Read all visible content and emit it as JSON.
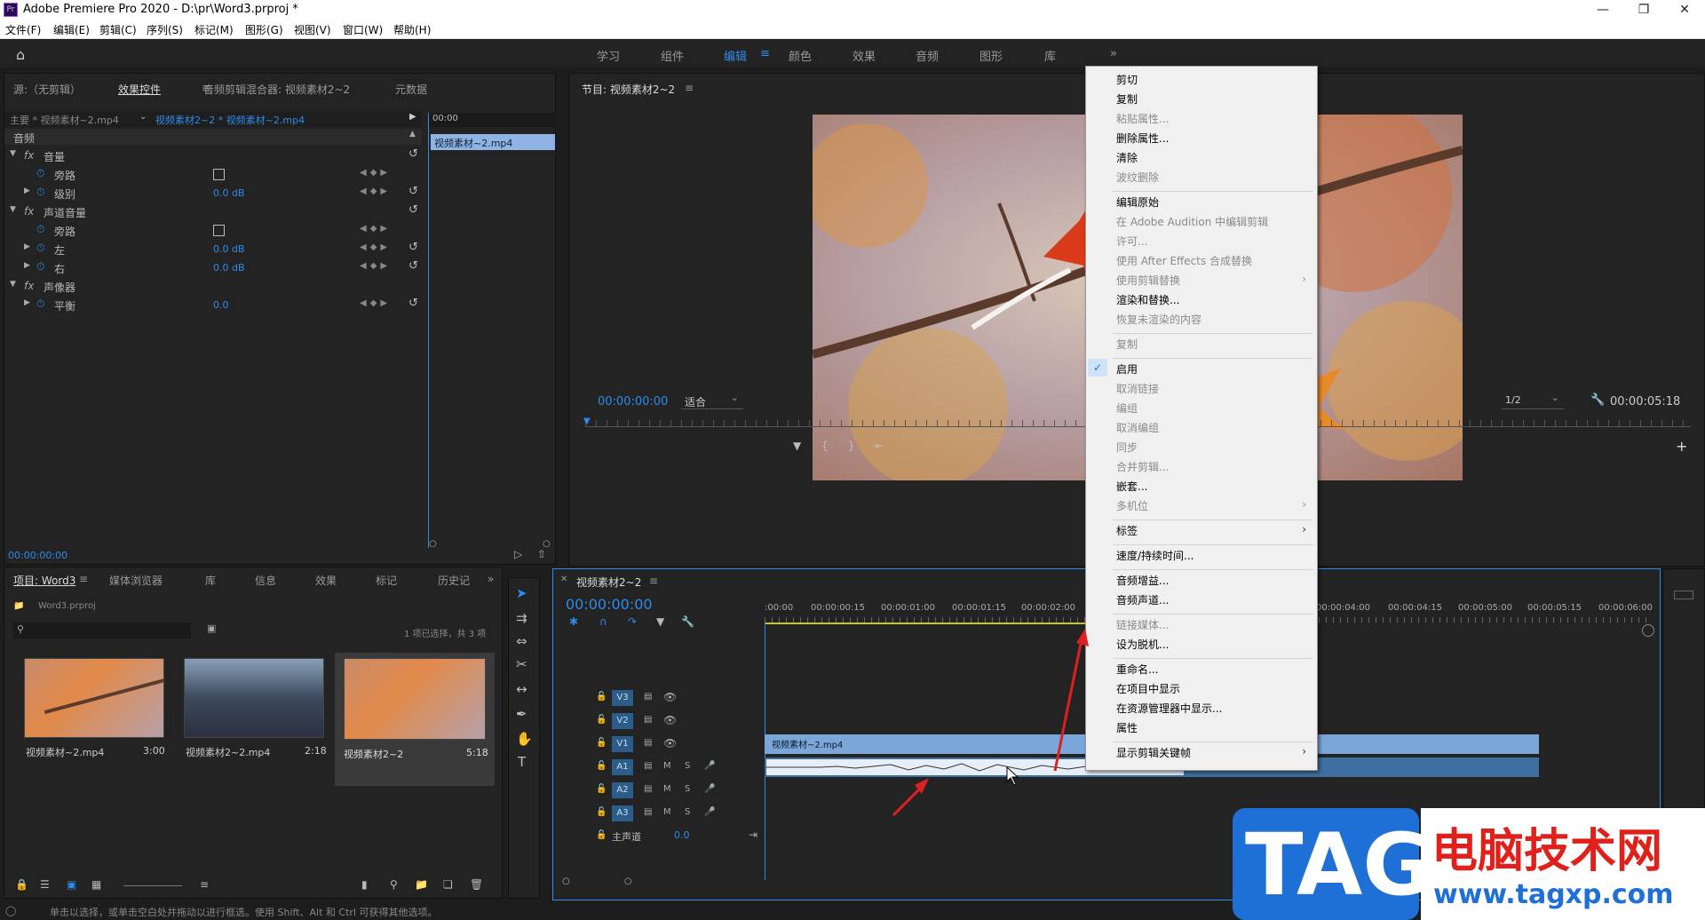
{
  "window": {
    "title": "Adobe Premiere Pro 2020 - D:\\pr\\Word3.prproj *",
    "app_icon": "Pr"
  },
  "menu": [
    "文件(F)",
    "编辑(E)",
    "剪辑(C)",
    "序列(S)",
    "标记(M)",
    "图形(G)",
    "视图(V)",
    "窗口(W)",
    "帮助(H)"
  ],
  "workspaces": [
    "学习",
    "组件",
    "编辑",
    "颜色",
    "效果",
    "音频",
    "图形",
    "库"
  ],
  "workspace_more": "»",
  "source_panel": {
    "tabs": [
      "源:（无剪辑）",
      "效果控件",
      "音频剪辑混合器: 视频素材2~2",
      "元数据"
    ],
    "tab_menu": "≡",
    "clip_path_main": "主要 * 视频素材~2.mp4",
    "clip_path_seq": "视频素材2~2 * 视频素材~2.mp4",
    "mini_time": "00:00",
    "mini_clip": "视频素材~2.mp4",
    "section": "音频",
    "rows": [
      {
        "label": "音量",
        "type": "fx"
      },
      {
        "label": "旁路",
        "type": "check"
      },
      {
        "label": "级别",
        "type": "value",
        "value": "0.0 dB"
      },
      {
        "label": "声道音量",
        "type": "fx"
      },
      {
        "label": "旁路",
        "type": "check"
      },
      {
        "label": "左",
        "type": "value",
        "value": "0.0 dB"
      },
      {
        "label": "右",
        "type": "value",
        "value": "0.0 dB"
      },
      {
        "label": "声像器",
        "type": "fx"
      },
      {
        "label": "平衡",
        "type": "value",
        "value": "0.0"
      }
    ],
    "timecode": "00:00:00:00"
  },
  "program_panel": {
    "title": "节目: 视频素材2~2",
    "timecode": "00:00:00:00",
    "fit": "适合",
    "resolution": "1/2",
    "duration": "00:00:05:18"
  },
  "project_panel": {
    "tabs": [
      "项目: Word3",
      "媒体浏览器",
      "库",
      "信息",
      "效果",
      "标记",
      "历史记"
    ],
    "file": "Word3.prproj",
    "selection": "1 项已选择，共 3 项",
    "items": [
      {
        "name": "视频素材~2.mp4",
        "dur": "3:00"
      },
      {
        "name": "视频素材2~2.mp4",
        "dur": "2:18"
      },
      {
        "name": "视频素材2~2",
        "dur": "5:18"
      }
    ]
  },
  "timeline": {
    "title": "视频素材2~2",
    "timecode": "00:00:00:00",
    "ruler": [
      ":00:00",
      "00:00:00:15",
      "00:00:01:00",
      "00:00:01:15",
      "00:00:02:00",
      "00:00:04:00",
      "00:00:04:15",
      "00:00:05:00",
      "00:00:05:15",
      "00:00:06:00"
    ],
    "video_tracks": [
      "V3",
      "V2",
      "V1"
    ],
    "audio_tracks": [
      "A1",
      "A2",
      "A3"
    ],
    "master": {
      "label": "主声道",
      "value": "0.0"
    },
    "clip_v1": "视频素材~2.mp4",
    "mute": "M",
    "solo": "S"
  },
  "context_menu": [
    {
      "label": "剪切",
      "enabled": true
    },
    {
      "label": "复制",
      "enabled": true
    },
    {
      "label": "粘贴属性...",
      "enabled": false
    },
    {
      "label": "删除属性...",
      "enabled": true
    },
    {
      "label": "清除",
      "enabled": true
    },
    {
      "label": "波纹删除",
      "enabled": false
    },
    {
      "sep": true
    },
    {
      "label": "编辑原始",
      "enabled": true
    },
    {
      "label": "在 Adobe Audition 中编辑剪辑",
      "enabled": false
    },
    {
      "label": "许可...",
      "enabled": false
    },
    {
      "label": "使用 After Effects 合成替换",
      "enabled": false
    },
    {
      "label": "使用剪辑替换",
      "enabled": false,
      "submenu": true
    },
    {
      "label": "渲染和替换...",
      "enabled": true
    },
    {
      "label": "恢复未渲染的内容",
      "enabled": false
    },
    {
      "sep": true
    },
    {
      "label": "复制",
      "enabled": false
    },
    {
      "sep": true
    },
    {
      "label": "启用",
      "enabled": true,
      "checked": true
    },
    {
      "label": "取消链接",
      "enabled": false
    },
    {
      "label": "编组",
      "enabled": false
    },
    {
      "label": "取消编组",
      "enabled": false
    },
    {
      "label": "同步",
      "enabled": false
    },
    {
      "label": "合并剪辑...",
      "enabled": false
    },
    {
      "label": "嵌套...",
      "enabled": true
    },
    {
      "label": "多机位",
      "enabled": false,
      "submenu": true
    },
    {
      "sep": true
    },
    {
      "label": "标签",
      "enabled": true,
      "submenu": true
    },
    {
      "sep": true
    },
    {
      "label": "速度/持续时间...",
      "enabled": true
    },
    {
      "sep": true
    },
    {
      "label": "音频增益...",
      "enabled": true
    },
    {
      "label": "音频声道...",
      "enabled": true
    },
    {
      "sep": true
    },
    {
      "label": "链接媒体...",
      "enabled": false
    },
    {
      "label": "设为脱机...",
      "enabled": true
    },
    {
      "sep": true
    },
    {
      "label": "重命名...",
      "enabled": true
    },
    {
      "label": "在项目中显示",
      "enabled": true
    },
    {
      "label": "在资源管理器中显示...",
      "enabled": true
    },
    {
      "label": "属性",
      "enabled": true
    },
    {
      "sep": true
    },
    {
      "label": "显示剪辑关键帧",
      "enabled": true,
      "submenu": true
    }
  ],
  "statusbar": "单击以选择，或单击空白处并拖动以进行框选。使用 Shift、Alt 和 Ctrl 可获得其他选项。",
  "watermark": {
    "tag": "TAG",
    "cn": "电脑技术网",
    "url": "www.tagxp.com"
  },
  "colors": {
    "accent": "#2d8ceb",
    "clip": "#7aa6d8",
    "menu_bg": "#f0f0f0",
    "arrow": "#e02020"
  }
}
